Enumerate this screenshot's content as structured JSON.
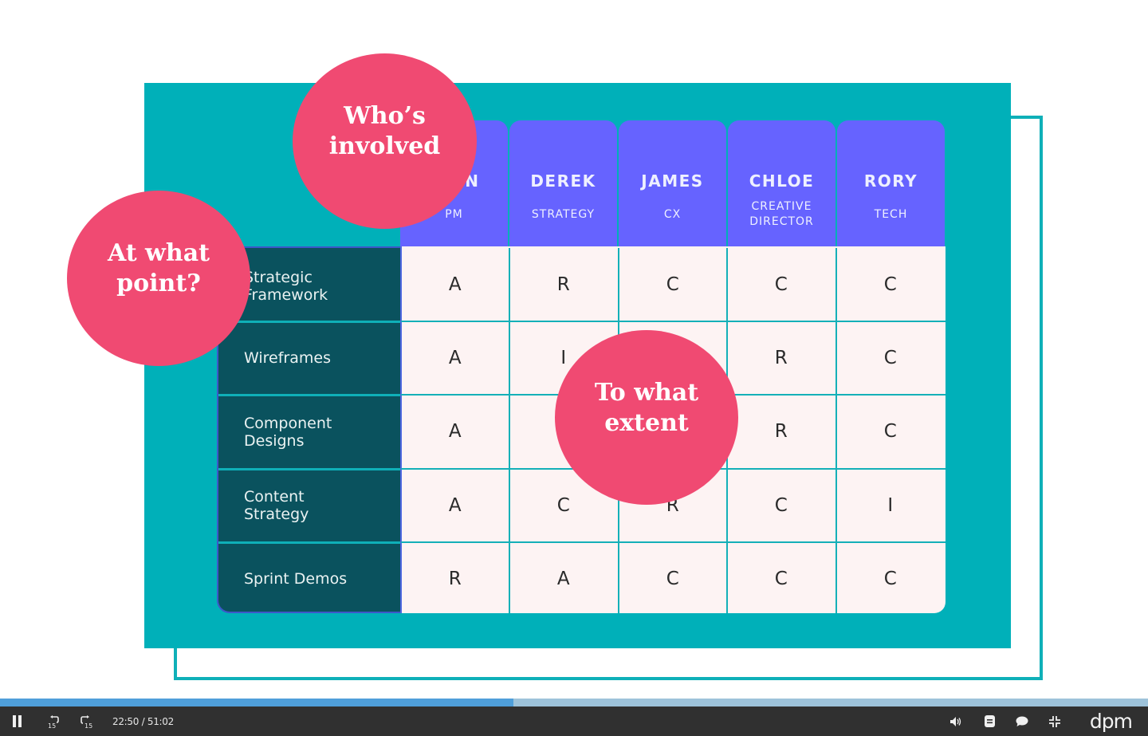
{
  "slide": {
    "columns": [
      {
        "name": "JOHN",
        "role": "PM"
      },
      {
        "name": "DEREK",
        "role": "STRATEGY"
      },
      {
        "name": "JAMES",
        "role": "CX"
      },
      {
        "name": "CHLOE",
        "role": "CREATIVE DIRECTOR"
      },
      {
        "name": "RORY",
        "role": "TECH"
      }
    ],
    "rows": [
      {
        "label": "Strategic Framework",
        "cells": [
          "A",
          "R",
          "C",
          "C",
          "C"
        ]
      },
      {
        "label": "Wireframes",
        "cells": [
          "A",
          "I",
          "",
          "R",
          "C"
        ]
      },
      {
        "label": "Component Designs",
        "cells": [
          "A",
          "",
          "",
          "R",
          "C"
        ]
      },
      {
        "label": "Content Strategy",
        "cells": [
          "A",
          "C",
          "R",
          "C",
          "I"
        ]
      },
      {
        "label": "Sprint Demos",
        "cells": [
          "R",
          "A",
          "C",
          "C",
          "C"
        ]
      }
    ],
    "bubbles": {
      "who": "Who’s\ninvolved",
      "when": "At what\npoint?",
      "extent": "To what\nextent"
    },
    "colors": {
      "teal": "#00b0b9",
      "header_purple": "#6663ff",
      "row_dark": "#0a525e",
      "bubble_pink": "#f04a72",
      "cell_bg": "#fdf3f3"
    }
  },
  "player": {
    "progress_fraction": 0.447,
    "current_time": "22:50",
    "duration": "51:02",
    "time_display": "22:50 / 51:02",
    "rewind_seconds": "15",
    "forward_seconds": "15",
    "logo": "dpm",
    "icons": {
      "play_pause": "pause-icon",
      "rewind": "rewind-15-icon",
      "forward": "forward-15-icon",
      "volume": "volume-icon",
      "transcript": "transcript-icon",
      "chat": "chat-icon",
      "fullscreen": "exit-fullscreen-icon"
    }
  }
}
